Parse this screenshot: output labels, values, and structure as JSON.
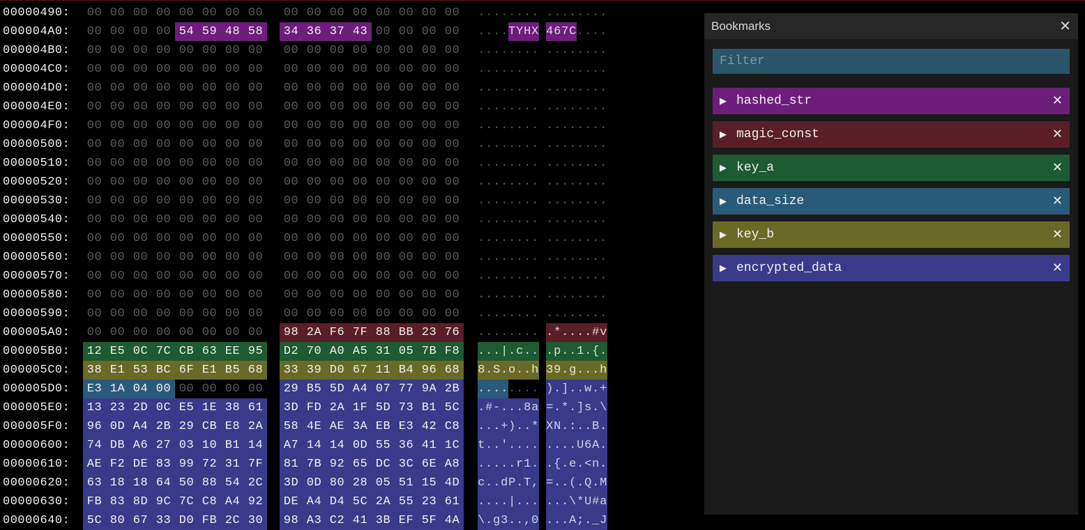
{
  "panel": {
    "title": "Bookmarks",
    "filter_placeholder": "Filter"
  },
  "bookmarks": [
    {
      "id": "hashed_str",
      "label": "hashed_str",
      "class": "bm-hashed"
    },
    {
      "id": "magic_const",
      "label": "magic_const",
      "class": "bm-magic"
    },
    {
      "id": "key_a",
      "label": "key_a",
      "class": "bm-keya"
    },
    {
      "id": "data_size",
      "label": "data_size",
      "class": "bm-datasize"
    },
    {
      "id": "key_b",
      "label": "key_b",
      "class": "bm-keyb"
    },
    {
      "id": "encrypted_data",
      "label": "encrypted_data",
      "class": "bm-enc"
    }
  ],
  "hex_rows": [
    {
      "addr": "00000490:",
      "bytes": [
        "00",
        "00",
        "00",
        "00",
        "00",
        "00",
        "00",
        "00",
        "00",
        "00",
        "00",
        "00",
        "00",
        "00",
        "00",
        "00"
      ],
      "ascii": "................",
      "hl": []
    },
    {
      "addr": "000004A0:",
      "bytes": [
        "00",
        "00",
        "00",
        "00",
        "54",
        "59",
        "48",
        "58",
        "34",
        "36",
        "37",
        "43",
        "00",
        "00",
        "00",
        "00"
      ],
      "ascii": "....TYHX467C....",
      "hl": [
        [
          "c-hashed",
          4,
          11
        ]
      ]
    },
    {
      "addr": "000004B0:",
      "bytes": [
        "00",
        "00",
        "00",
        "00",
        "00",
        "00",
        "00",
        "00",
        "00",
        "00",
        "00",
        "00",
        "00",
        "00",
        "00",
        "00"
      ],
      "ascii": "................",
      "hl": []
    },
    {
      "addr": "000004C0:",
      "bytes": [
        "00",
        "00",
        "00",
        "00",
        "00",
        "00",
        "00",
        "00",
        "00",
        "00",
        "00",
        "00",
        "00",
        "00",
        "00",
        "00"
      ],
      "ascii": "................",
      "hl": []
    },
    {
      "addr": "000004D0:",
      "bytes": [
        "00",
        "00",
        "00",
        "00",
        "00",
        "00",
        "00",
        "00",
        "00",
        "00",
        "00",
        "00",
        "00",
        "00",
        "00",
        "00"
      ],
      "ascii": "................",
      "hl": []
    },
    {
      "addr": "000004E0:",
      "bytes": [
        "00",
        "00",
        "00",
        "00",
        "00",
        "00",
        "00",
        "00",
        "00",
        "00",
        "00",
        "00",
        "00",
        "00",
        "00",
        "00"
      ],
      "ascii": "................",
      "hl": []
    },
    {
      "addr": "000004F0:",
      "bytes": [
        "00",
        "00",
        "00",
        "00",
        "00",
        "00",
        "00",
        "00",
        "00",
        "00",
        "00",
        "00",
        "00",
        "00",
        "00",
        "00"
      ],
      "ascii": "................",
      "hl": []
    },
    {
      "addr": "00000500:",
      "bytes": [
        "00",
        "00",
        "00",
        "00",
        "00",
        "00",
        "00",
        "00",
        "00",
        "00",
        "00",
        "00",
        "00",
        "00",
        "00",
        "00"
      ],
      "ascii": "................",
      "hl": []
    },
    {
      "addr": "00000510:",
      "bytes": [
        "00",
        "00",
        "00",
        "00",
        "00",
        "00",
        "00",
        "00",
        "00",
        "00",
        "00",
        "00",
        "00",
        "00",
        "00",
        "00"
      ],
      "ascii": "................",
      "hl": []
    },
    {
      "addr": "00000520:",
      "bytes": [
        "00",
        "00",
        "00",
        "00",
        "00",
        "00",
        "00",
        "00",
        "00",
        "00",
        "00",
        "00",
        "00",
        "00",
        "00",
        "00"
      ],
      "ascii": "................",
      "hl": []
    },
    {
      "addr": "00000530:",
      "bytes": [
        "00",
        "00",
        "00",
        "00",
        "00",
        "00",
        "00",
        "00",
        "00",
        "00",
        "00",
        "00",
        "00",
        "00",
        "00",
        "00"
      ],
      "ascii": "................",
      "hl": []
    },
    {
      "addr": "00000540:",
      "bytes": [
        "00",
        "00",
        "00",
        "00",
        "00",
        "00",
        "00",
        "00",
        "00",
        "00",
        "00",
        "00",
        "00",
        "00",
        "00",
        "00"
      ],
      "ascii": "................",
      "hl": []
    },
    {
      "addr": "00000550:",
      "bytes": [
        "00",
        "00",
        "00",
        "00",
        "00",
        "00",
        "00",
        "00",
        "00",
        "00",
        "00",
        "00",
        "00",
        "00",
        "00",
        "00"
      ],
      "ascii": "................",
      "hl": []
    },
    {
      "addr": "00000560:",
      "bytes": [
        "00",
        "00",
        "00",
        "00",
        "00",
        "00",
        "00",
        "00",
        "00",
        "00",
        "00",
        "00",
        "00",
        "00",
        "00",
        "00"
      ],
      "ascii": "................",
      "hl": []
    },
    {
      "addr": "00000570:",
      "bytes": [
        "00",
        "00",
        "00",
        "00",
        "00",
        "00",
        "00",
        "00",
        "00",
        "00",
        "00",
        "00",
        "00",
        "00",
        "00",
        "00"
      ],
      "ascii": "................",
      "hl": []
    },
    {
      "addr": "00000580:",
      "bytes": [
        "00",
        "00",
        "00",
        "00",
        "00",
        "00",
        "00",
        "00",
        "00",
        "00",
        "00",
        "00",
        "00",
        "00",
        "00",
        "00"
      ],
      "ascii": "................",
      "hl": []
    },
    {
      "addr": "00000590:",
      "bytes": [
        "00",
        "00",
        "00",
        "00",
        "00",
        "00",
        "00",
        "00",
        "00",
        "00",
        "00",
        "00",
        "00",
        "00",
        "00",
        "00"
      ],
      "ascii": "................",
      "hl": []
    },
    {
      "addr": "000005A0:",
      "bytes": [
        "00",
        "00",
        "00",
        "00",
        "00",
        "00",
        "00",
        "00",
        "98",
        "2A",
        "F6",
        "7F",
        "88",
        "BB",
        "23",
        "76"
      ],
      "ascii": ".........*....#v",
      "hl": [
        [
          "c-magic",
          8,
          15
        ]
      ]
    },
    {
      "addr": "000005B0:",
      "bytes": [
        "12",
        "E5",
        "0C",
        "7C",
        "CB",
        "63",
        "EE",
        "95",
        "D2",
        "70",
        "A0",
        "A5",
        "31",
        "05",
        "7B",
        "F8"
      ],
      "ascii": "...|.c...p..1.{.",
      "hl": [
        [
          "c-keya",
          0,
          15
        ]
      ]
    },
    {
      "addr": "000005C0:",
      "bytes": [
        "38",
        "E1",
        "53",
        "BC",
        "6F",
        "E1",
        "B5",
        "68",
        "33",
        "39",
        "D0",
        "67",
        "11",
        "B4",
        "96",
        "68"
      ],
      "ascii": "8.S.o..h39.g...h",
      "hl": [
        [
          "c-keyb",
          0,
          15
        ]
      ]
    },
    {
      "addr": "000005D0:",
      "bytes": [
        "E3",
        "1A",
        "04",
        "00",
        "00",
        "00",
        "00",
        "00",
        "29",
        "B5",
        "5D",
        "A4",
        "07",
        "77",
        "9A",
        "2B"
      ],
      "ascii": "........).]..w.+",
      "hl": [
        [
          "c-datasize",
          0,
          3
        ],
        [
          "c-enc",
          8,
          15
        ]
      ]
    },
    {
      "addr": "000005E0:",
      "bytes": [
        "13",
        "23",
        "2D",
        "0C",
        "E5",
        "1E",
        "38",
        "61",
        "3D",
        "FD",
        "2A",
        "1F",
        "5D",
        "73",
        "B1",
        "5C"
      ],
      "ascii": ".#-...8a=.*.]s.\\",
      "hl": [
        [
          "c-enc",
          0,
          15
        ]
      ]
    },
    {
      "addr": "000005F0:",
      "bytes": [
        "96",
        "0D",
        "A4",
        "2B",
        "29",
        "CB",
        "E8",
        "2A",
        "58",
        "4E",
        "AE",
        "3A",
        "EB",
        "E3",
        "42",
        "C8"
      ],
      "ascii": "...+)..*XN.:..B.",
      "hl": [
        [
          "c-enc",
          0,
          15
        ]
      ]
    },
    {
      "addr": "00000600:",
      "bytes": [
        "74",
        "DB",
        "A6",
        "27",
        "03",
        "10",
        "B1",
        "14",
        "A7",
        "14",
        "14",
        "0D",
        "55",
        "36",
        "41",
        "1C"
      ],
      "ascii": "t..'........U6A.",
      "hl": [
        [
          "c-enc",
          0,
          15
        ]
      ]
    },
    {
      "addr": "00000610:",
      "bytes": [
        "AE",
        "F2",
        "DE",
        "83",
        "99",
        "72",
        "31",
        "7F",
        "81",
        "7B",
        "92",
        "65",
        "DC",
        "3C",
        "6E",
        "A8"
      ],
      "ascii": ".....r1..{.e.<n.",
      "hl": [
        [
          "c-enc",
          0,
          15
        ]
      ]
    },
    {
      "addr": "00000620:",
      "bytes": [
        "63",
        "18",
        "18",
        "64",
        "50",
        "88",
        "54",
        "2C",
        "3D",
        "0D",
        "80",
        "28",
        "05",
        "51",
        "15",
        "4D"
      ],
      "ascii": "c..dP.T,=..(.Q.M",
      "hl": [
        [
          "c-enc",
          0,
          15
        ]
      ]
    },
    {
      "addr": "00000630:",
      "bytes": [
        "FB",
        "83",
        "8D",
        "9C",
        "7C",
        "C8",
        "A4",
        "92",
        "DE",
        "A4",
        "D4",
        "5C",
        "2A",
        "55",
        "23",
        "61"
      ],
      "ascii": "....|......\\*U#a",
      "hl": [
        [
          "c-enc",
          0,
          15
        ]
      ]
    },
    {
      "addr": "00000640:",
      "bytes": [
        "5C",
        "80",
        "67",
        "33",
        "D0",
        "FB",
        "2C",
        "30",
        "98",
        "A3",
        "C2",
        "41",
        "3B",
        "EF",
        "5F",
        "4A"
      ],
      "ascii": "\\.g3..,0...A;._J",
      "hl": [
        [
          "c-enc",
          0,
          15
        ]
      ]
    }
  ]
}
